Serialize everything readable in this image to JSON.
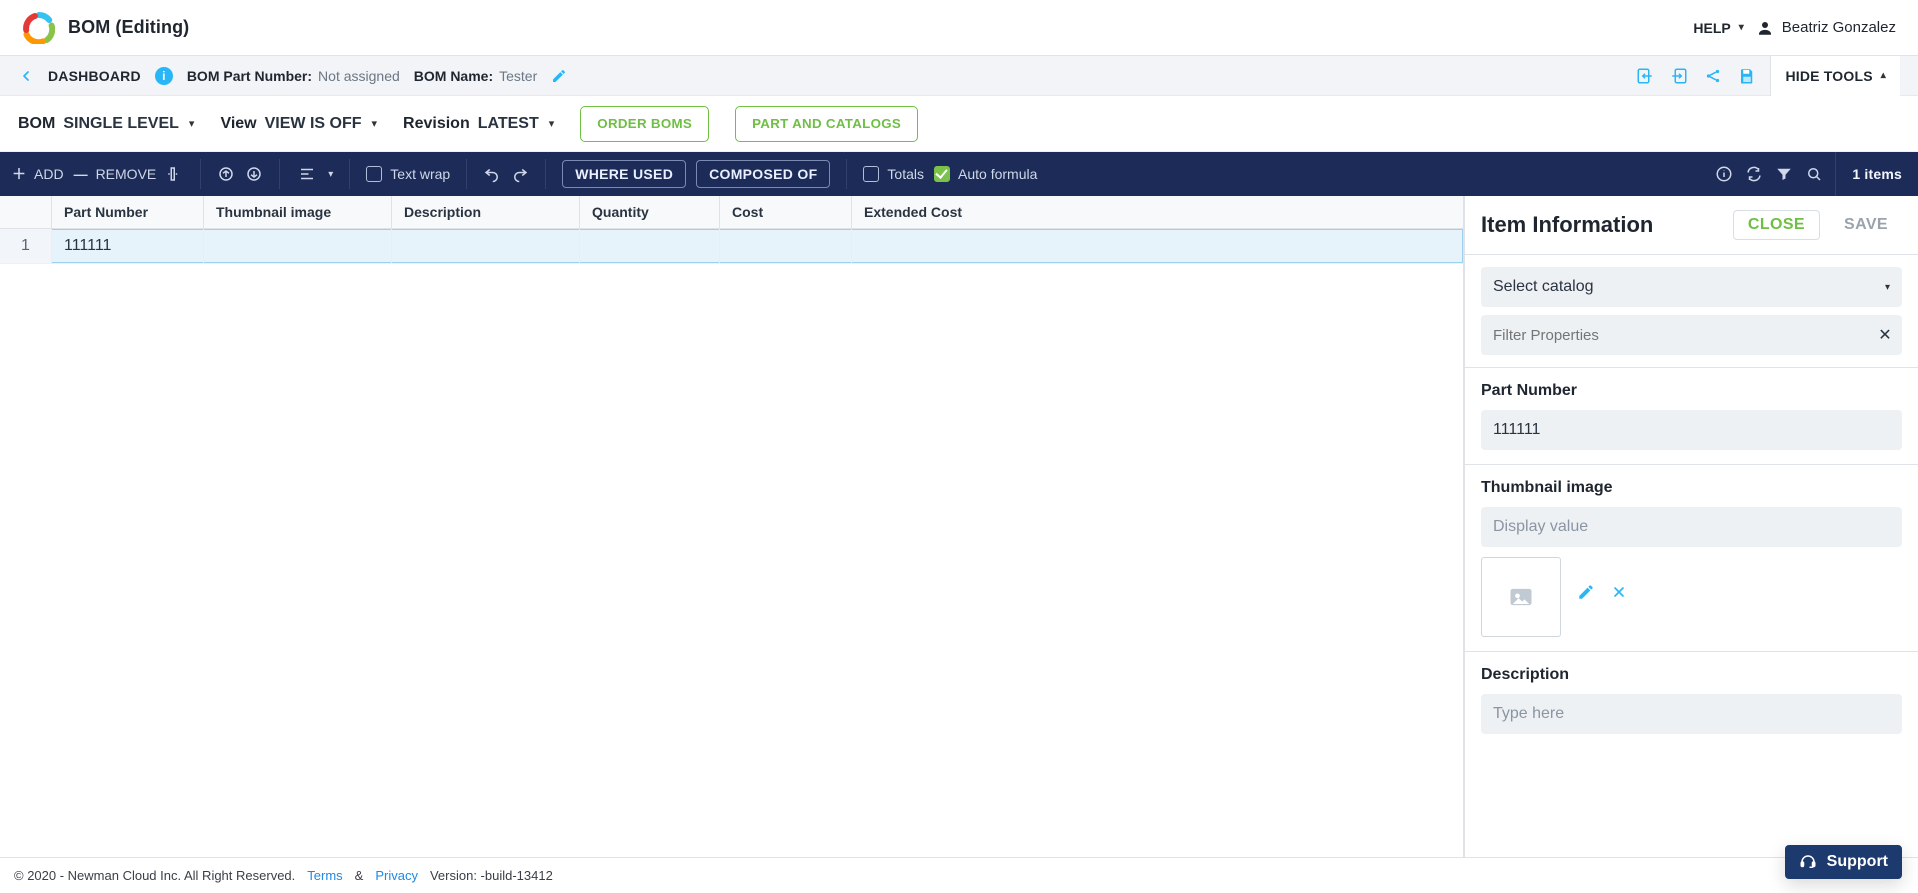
{
  "header": {
    "title": "BOM (Editing)",
    "help_label": "HELP",
    "user_name": "Beatriz Gonzalez"
  },
  "context": {
    "dashboard_label": "DASHBOARD",
    "part_number_label": "BOM Part Number:",
    "part_number_value": "Not assigned",
    "bom_name_label": "BOM Name:",
    "bom_name_value": "Tester",
    "hide_tools_label": "HIDE TOOLS"
  },
  "controls": {
    "bom": {
      "label": "BOM",
      "value": "SINGLE LEVEL"
    },
    "view": {
      "label": "View",
      "value": "VIEW IS OFF"
    },
    "revision": {
      "label": "Revision",
      "value": "LATEST"
    },
    "order_boms": "ORDER BOMS",
    "part_catalogs": "PART AND CATALOGS"
  },
  "toolbar": {
    "add": "ADD",
    "remove": "REMOVE",
    "text_wrap": "Text wrap",
    "where_used": "WHERE USED",
    "composed_of": "COMPOSED OF",
    "totals": "Totals",
    "auto_formula": "Auto formula",
    "items_count": "1 items"
  },
  "grid": {
    "columns": [
      "",
      "Part Number",
      "Thumbnail image",
      "Description",
      "Quantity",
      "Cost",
      "Extended Cost"
    ],
    "rows": [
      {
        "index": 1,
        "part_number": "111111",
        "thumbnail": "",
        "description": "",
        "quantity": "",
        "cost": "",
        "extended_cost": ""
      }
    ]
  },
  "side": {
    "title": "Item Information",
    "close": "CLOSE",
    "save": "SAVE",
    "catalog_placeholder": "Select catalog",
    "filter_placeholder": "Filter Properties",
    "part_number_label": "Part Number",
    "part_number_value": "111111",
    "thumbnail_label": "Thumbnail image",
    "thumbnail_placeholder": "Display value",
    "description_label": "Description",
    "description_placeholder": "Type here"
  },
  "footer": {
    "copyright": "© 2020 - Newman Cloud Inc. All Right Reserved.",
    "terms": "Terms",
    "amp": "&",
    "privacy": "Privacy",
    "version": "Version: -build-13412"
  },
  "support": {
    "label": "Support"
  }
}
